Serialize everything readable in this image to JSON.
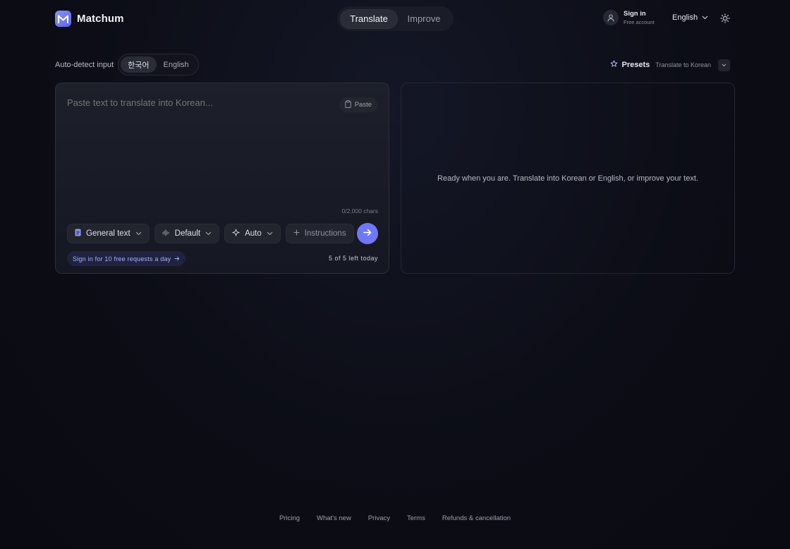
{
  "brand": {
    "name": "Matchum"
  },
  "header": {
    "modes": [
      {
        "label": "Translate"
      },
      {
        "label": "Improve"
      }
    ],
    "signin": {
      "title": "Sign in",
      "subtitle": "Free account"
    },
    "ui_language": "English"
  },
  "input_lang": {
    "label": "Auto-detect input",
    "options": [
      {
        "label": "한국어"
      },
      {
        "label": "English"
      }
    ],
    "selected": "한국어"
  },
  "presets": {
    "label": "Presets",
    "value": "Translate to Korean"
  },
  "input": {
    "placeholder": "Paste text to translate into Korean...",
    "paste_label": "Paste",
    "char_count": "0/2,000 chars",
    "controls": {
      "type": "General text",
      "tone": "Default",
      "model": "Auto",
      "instructions": "Instructions"
    },
    "signin_hint": "Sign in for 10 free requests a day",
    "quota": "5 of 5 left today"
  },
  "output": {
    "message": "Ready when you are. Translate into Korean or English, or improve your text."
  },
  "footer": {
    "links": [
      {
        "label": "Pricing"
      },
      {
        "label": "What's new"
      },
      {
        "label": "Privacy"
      },
      {
        "label": "Terms"
      },
      {
        "label": "Refunds & cancellation"
      }
    ]
  },
  "colors": {
    "accent": "#6f78f6",
    "background": "#0c0d16",
    "panel": "#1a1c27"
  },
  "icons": [
    "logo-m-icon",
    "user-icon",
    "chevron-down-icon",
    "sun-icon",
    "star-icon",
    "clipboard-icon",
    "document-icon",
    "waveform-icon",
    "sparkle-icon",
    "plus-icon",
    "arrow-right-icon"
  ]
}
